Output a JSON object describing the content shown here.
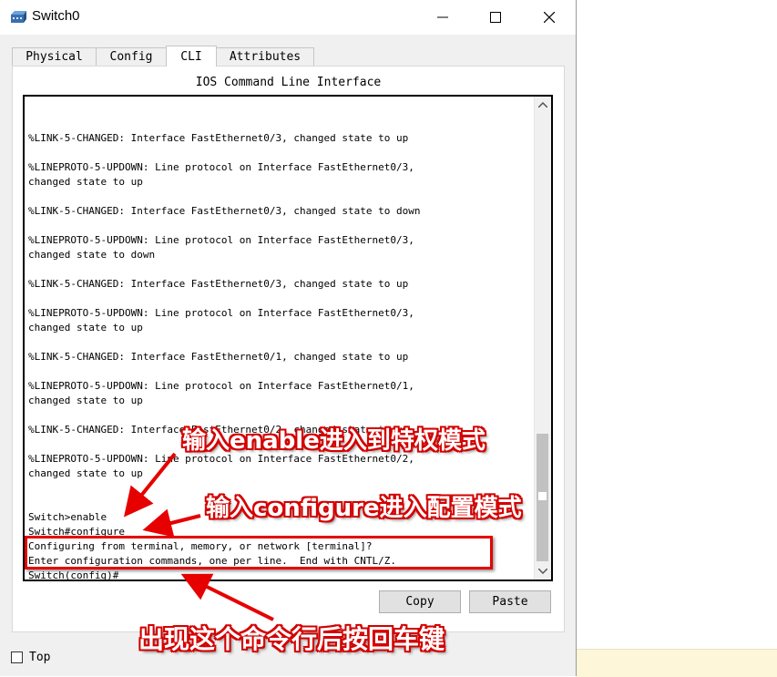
{
  "window": {
    "title": "Switch0",
    "minimize_glyph": "—",
    "maximize_glyph": "☐",
    "close_glyph": "✕"
  },
  "tabs": [
    {
      "label": "Physical",
      "active": false
    },
    {
      "label": "Config",
      "active": false
    },
    {
      "label": "CLI",
      "active": true
    },
    {
      "label": "Attributes",
      "active": false
    }
  ],
  "cli": {
    "panel_title": "IOS Command Line Interface",
    "lines": [
      "%LINK-5-CHANGED: Interface FastEthernet0/3, changed state to up",
      "",
      "%LINEPROTO-5-UPDOWN: Line protocol on Interface FastEthernet0/3,",
      "changed state to up",
      "",
      "%LINK-5-CHANGED: Interface FastEthernet0/3, changed state to down",
      "",
      "%LINEPROTO-5-UPDOWN: Line protocol on Interface FastEthernet0/3,",
      "changed state to down",
      "",
      "%LINK-5-CHANGED: Interface FastEthernet0/3, changed state to up",
      "",
      "%LINEPROTO-5-UPDOWN: Line protocol on Interface FastEthernet0/3,",
      "changed state to up",
      "",
      "%LINK-5-CHANGED: Interface FastEthernet0/1, changed state to up",
      "",
      "%LINEPROTO-5-UPDOWN: Line protocol on Interface FastEthernet0/1,",
      "changed state to up",
      "",
      "%LINK-5-CHANGED: Interface FastEthernet0/2, changed state to up",
      "",
      "%LINEPROTO-5-UPDOWN: Line protocol on Interface FastEthernet0/2,",
      "changed state to up",
      "",
      "",
      "Switch>enable",
      "Switch#configure",
      "Configuring from terminal, memory, or network [terminal]?",
      "Enter configuration commands, one per line.  End with CNTL/Z.",
      "Switch(config)#"
    ]
  },
  "buttons": {
    "copy": "Copy",
    "paste": "Paste"
  },
  "top_checkbox": {
    "label": "Top",
    "checked": false
  },
  "annotations": {
    "enable_note": "输入enable进入到特权模式",
    "configure_note": "输入configure进入配置模式",
    "enter_note": "出现这个命令行后按回车键",
    "color": "#e60000"
  }
}
